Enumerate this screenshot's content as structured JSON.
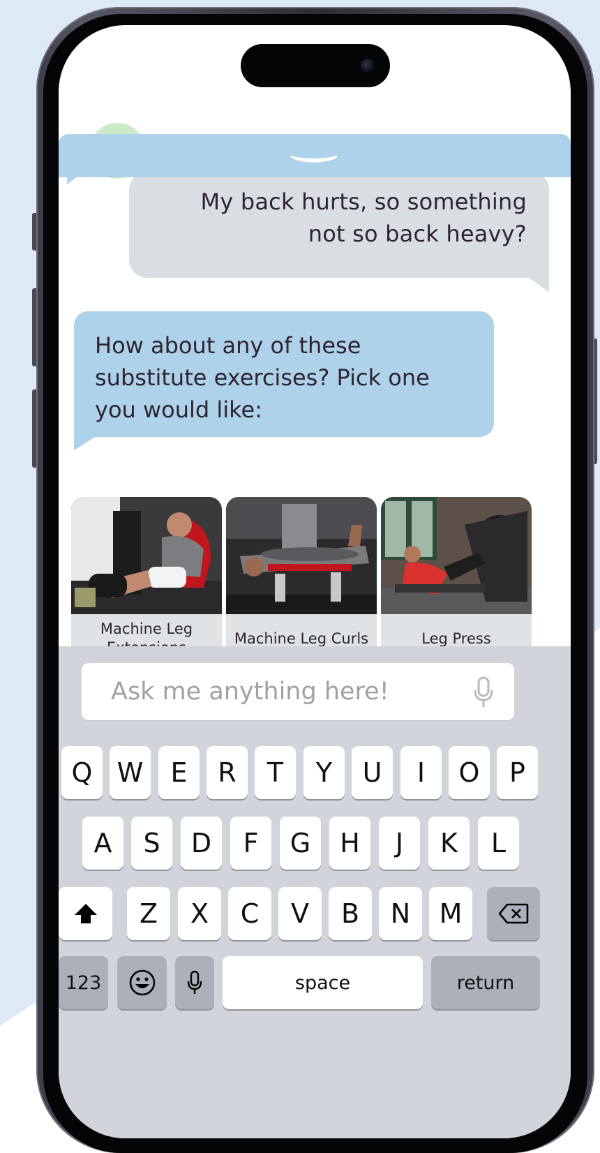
{
  "colors": {
    "page_background": "#ddeaf5",
    "bot_bubble": "#aed2ea",
    "user_bubble": "#d9dee2",
    "keyboard": "#d1d5db"
  },
  "chat": {
    "user_message": "My back hurts, so something not so back heavy?",
    "bot_message": "How about any of these substitute exercises? Pick one you would like:"
  },
  "exercises": [
    {
      "label": "Machine Leg Extensions"
    },
    {
      "label": "Machine Leg Curls"
    },
    {
      "label": "Leg Press"
    }
  ],
  "composer": {
    "placeholder": "Ask me anything here!",
    "mic_icon": "microphone-icon"
  },
  "keyboard": {
    "row1": [
      "Q",
      "W",
      "E",
      "R",
      "T",
      "Y",
      "U",
      "I",
      "O",
      "P"
    ],
    "row2": [
      "A",
      "S",
      "D",
      "F",
      "G",
      "H",
      "J",
      "K",
      "L"
    ],
    "row3": [
      "Z",
      "X",
      "C",
      "V",
      "B",
      "N",
      "M"
    ],
    "shift_icon": "shift-icon",
    "backspace_icon": "backspace-icon",
    "numbers_label": "123",
    "emoji_icon": "emoji-icon",
    "dictation_icon": "microphone-icon",
    "space_label": "space",
    "return_label": "return"
  }
}
